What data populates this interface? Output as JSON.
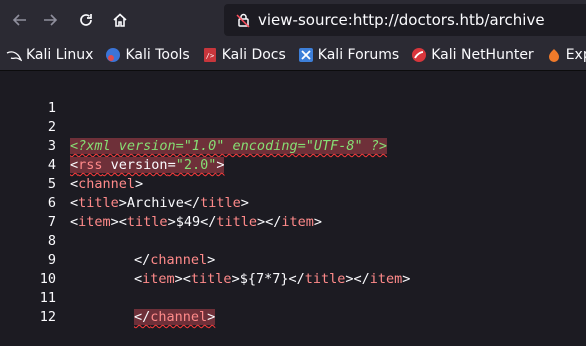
{
  "browser": {
    "url": "view-source:http://doctors.htb/archive"
  },
  "bookmarks": [
    {
      "label": "Kali Linux",
      "icon": "kali-dragon-icon"
    },
    {
      "label": "Kali Tools",
      "icon": "kali-tools-icon"
    },
    {
      "label": "Kali Docs",
      "icon": "kali-docs-icon"
    },
    {
      "label": "Kali Forums",
      "icon": "kali-forums-icon"
    },
    {
      "label": "Kali NetHunter",
      "icon": "kali-nethunter-icon"
    },
    {
      "label": "Exploit",
      "icon": "exploit-db-icon"
    }
  ],
  "source": {
    "line_numbers": [
      "1",
      "2",
      "3",
      "4",
      "5",
      "6",
      "7",
      "8",
      "9",
      "10",
      "11",
      "12"
    ],
    "line2": {
      "pi": "<?xml version=\"1.0\" encoding=\"UTF-8\" ?>"
    },
    "line3": {
      "open": "<",
      "name": "rss",
      "attr": " version",
      "eq": "=",
      "val": "\"2.0\"",
      "close": ">"
    },
    "line4": {
      "open": "<",
      "name": "channel",
      "close": ">"
    },
    "line5": {
      "t1": "<",
      "n1": "title",
      "t2": ">",
      "text": "Archive",
      "t3": "</",
      "n2": "title",
      "t4": ">"
    },
    "line6": {
      "t1": "<",
      "n1": "item",
      "t2": "><",
      "n2": "title",
      "t3": ">",
      "text": "$49",
      "t4": "</",
      "n3": "title",
      "t5": "></",
      "n4": "item",
      "t6": ">"
    },
    "line8": {
      "t1": "</",
      "n1": "channel",
      "t2": ">"
    },
    "line9": {
      "t1": "<",
      "n1": "item",
      "t2": "><",
      "n2": "title",
      "t3": ">",
      "text": "${7*7}",
      "t4": "</",
      "n3": "title",
      "t5": "></",
      "n4": "item",
      "t6": ">"
    },
    "line11": {
      "t1": "</",
      "n1": "channel",
      "t2": ">"
    }
  },
  "colors": {
    "background": "#1c1b22",
    "toolbar": "#2b2a33",
    "tag_name": "#ff8a8a",
    "attr_value": "#86de74",
    "error_highlight": "#6e3039"
  }
}
